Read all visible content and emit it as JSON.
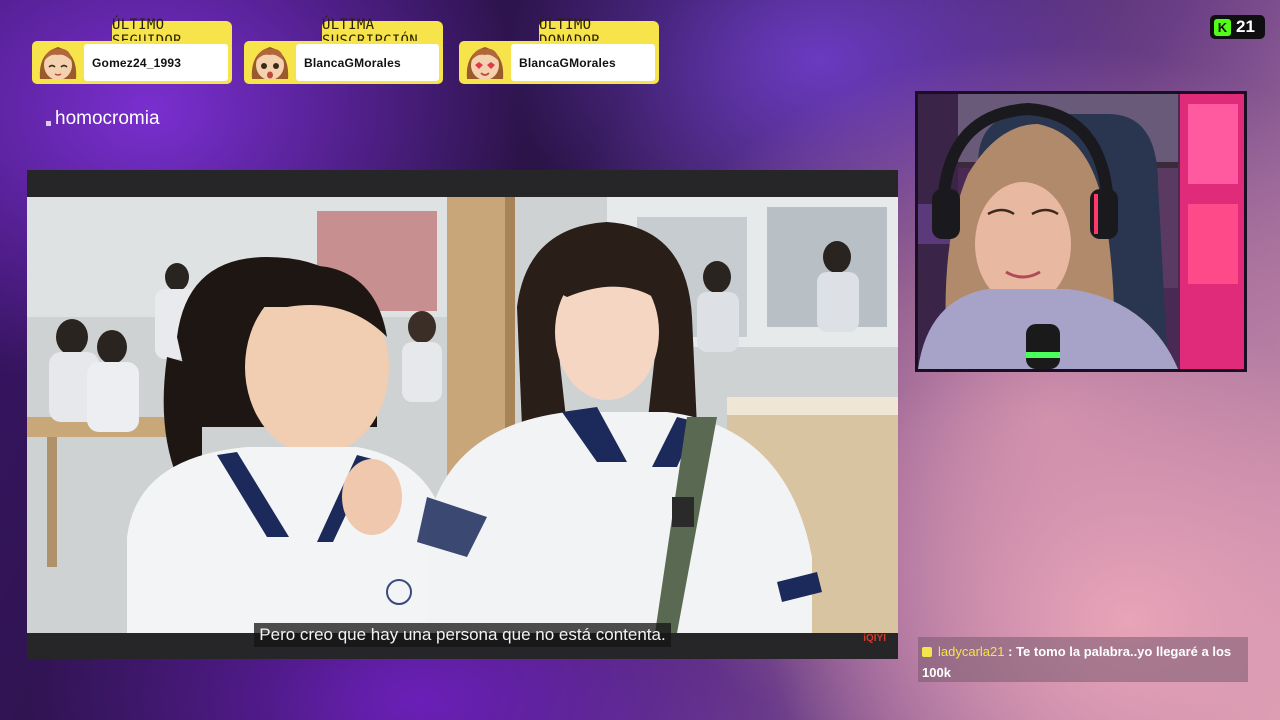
{
  "alerts": [
    {
      "label": "ÚLTIMO SEGUIDOR",
      "name": "Gomez24_1993"
    },
    {
      "label": "ÚLTIMA SUSCRIPCIÓN",
      "name": "BlancaGMorales"
    },
    {
      "label": "ÚLTIMO DONADOR",
      "name": "BlancaGMorales"
    }
  ],
  "topic": "homocromia",
  "video": {
    "subtitle": "Pero creo que hay una persona que no está contenta.",
    "watermark": "iQIYI"
  },
  "viewer_badge": {
    "logo": "K",
    "count": "21"
  },
  "chat": {
    "user": "ladycarla21",
    "separator": " : ",
    "message": "Te tomo la palabra..yo llegaré a los 100k"
  },
  "colors": {
    "alert_yellow": "#f7e34a",
    "kick_green": "#53fc18"
  },
  "icons": [
    "avatar-icon",
    "webcam-feed",
    "user-badge-icon"
  ]
}
